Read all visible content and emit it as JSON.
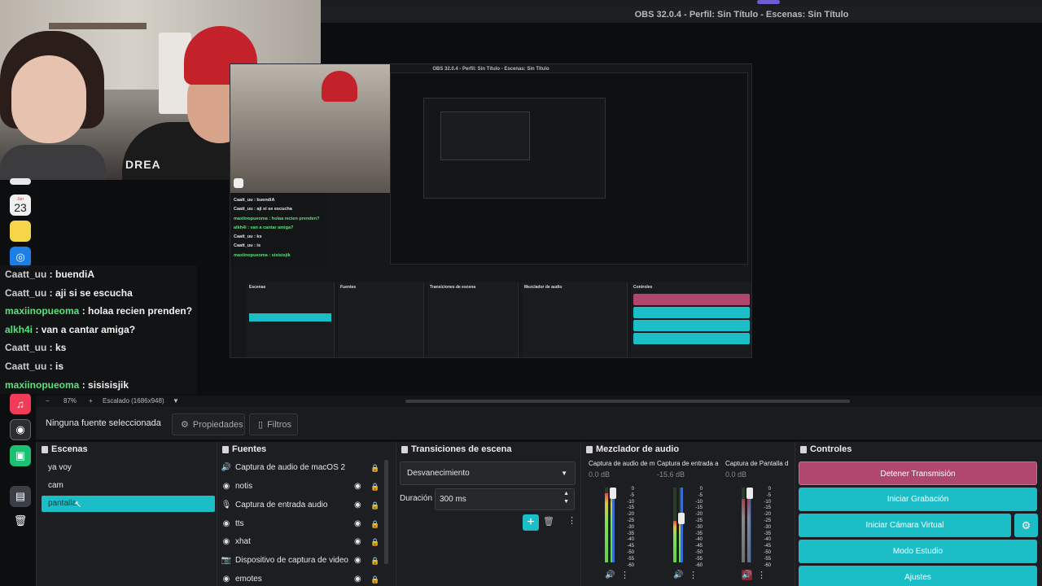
{
  "window": {
    "title": "OBS 32.0.4 - Perfil: Sin Título - Escenas: Sin Título"
  },
  "webcam": {
    "shirt_text": "DREA"
  },
  "dock": {
    "calendar_month": "Jun",
    "calendar_day": "23"
  },
  "chat": [
    {
      "user": "Caatt_uu",
      "msg": " : buendiA",
      "green": false
    },
    {
      "user": "Caatt_uu",
      "msg": " : aji si se escucha",
      "green": false
    },
    {
      "user": "maxiinopueoma",
      "msg": " : holaa recien prenden?",
      "green": true
    },
    {
      "user": "alkh4i",
      "msg": " : van a cantar amiga?",
      "green": true
    },
    {
      "user": "Caatt_uu",
      "msg": " : ks",
      "green": false
    },
    {
      "user": "Caatt_uu",
      "msg": " : is",
      "green": false
    },
    {
      "user": "maxiinopueoma",
      "msg": " : sisisisjik",
      "green": true
    }
  ],
  "nested": {
    "title": "OBS 32.0.4 - Perfil: Sin Título - Escenas: Sin Título",
    "chat": [
      "Caatt_uu : buendiA",
      "Caatt_uu : aji si se escucha",
      "maxiinopueoma : holaa recien prenden?",
      "alkh4i : van a cantar amiga?",
      "Caatt_uu : ks",
      "Caatt_uu : is",
      "maxiinopueoma : sisisisjik"
    ]
  },
  "zoom": {
    "minus": "−",
    "level": "87%",
    "plus": "+",
    "scale": "Escalado (1686x948)",
    "caret": "▼"
  },
  "source_toolbar": {
    "no_source": "Ninguna fuente seleccionada",
    "properties": "Propiedades",
    "filters": "Filtros"
  },
  "scenes": {
    "title": "Escenas",
    "items": [
      "ya voy",
      "cam",
      "pantalla"
    ],
    "selected_index": 2
  },
  "sources": {
    "title": "Fuentes",
    "items": [
      {
        "label": "Captura de audio de macOS 2",
        "icon": "speaker-icon"
      },
      {
        "label": "notis",
        "icon": "globe-icon"
      },
      {
        "label": "Captura de entrada audio",
        "icon": "microphone-icon"
      },
      {
        "label": "tts",
        "icon": "globe-icon"
      },
      {
        "label": "xhat",
        "icon": "globe-icon"
      },
      {
        "label": "Dispositivo de captura de video",
        "icon": "camera-icon"
      },
      {
        "label": "emotes",
        "icon": "globe-icon"
      }
    ]
  },
  "transitions": {
    "title": "Transiciones de escena",
    "selected": "Desvanecimiento",
    "duration_label": "Duración",
    "duration_value": "300 ms"
  },
  "mixer": {
    "title": "Mezclador de audio",
    "scale": [
      "0",
      "-5",
      "-10",
      "-15",
      "-20",
      "-25",
      "-30",
      "-35",
      "-40",
      "-45",
      "-50",
      "-55",
      "-60"
    ],
    "channels": [
      {
        "name": "Captura de audio de m",
        "db": "0.0 dB",
        "level": 0.92,
        "fader": 1.0,
        "muted": false
      },
      {
        "name": "Captura de entrada a",
        "db": "-15.6 dB",
        "level": 0.55,
        "fader": 0.6,
        "muted": false
      },
      {
        "name": "Captura de Pantalla d",
        "db": "0.0 dB",
        "level": 0.85,
        "fader": 1.0,
        "muted": true
      }
    ]
  },
  "controls": {
    "title": "Controles",
    "stop_stream": "Detener Transmisión",
    "start_record": "Iniciar Grabación",
    "start_vcam": "Iniciar Cámara Virtual",
    "studio_mode": "Modo Estudio",
    "settings": "Ajustes"
  },
  "colors": {
    "accent": "#1bbdc6",
    "stop": "#b0476e",
    "panel": "#1d1e21"
  }
}
